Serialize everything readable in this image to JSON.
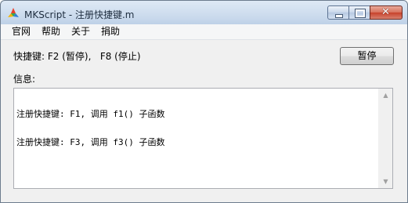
{
  "window": {
    "title": "MKScript - 注册快捷键.m",
    "close_glyph": "✕"
  },
  "menu": {
    "items": [
      "官网",
      "帮助",
      "关于",
      "捐助"
    ]
  },
  "main": {
    "hotkey_text": "快捷键: F2 (暂停),   F8 (停止)",
    "pause_button": "暂停",
    "info_label": "信息:",
    "log_lines": [
      "注册快捷键: F1, 调用 f1() 子函数",
      "注册快捷键: F3, 调用 f3() 子函数"
    ]
  },
  "scrollbar": {
    "up_glyph": "▲",
    "down_glyph": "▼"
  },
  "colors": {
    "titlebar": "#c9d9ec",
    "close_button": "#c7412b",
    "client_bg": "#f0f0f0"
  }
}
